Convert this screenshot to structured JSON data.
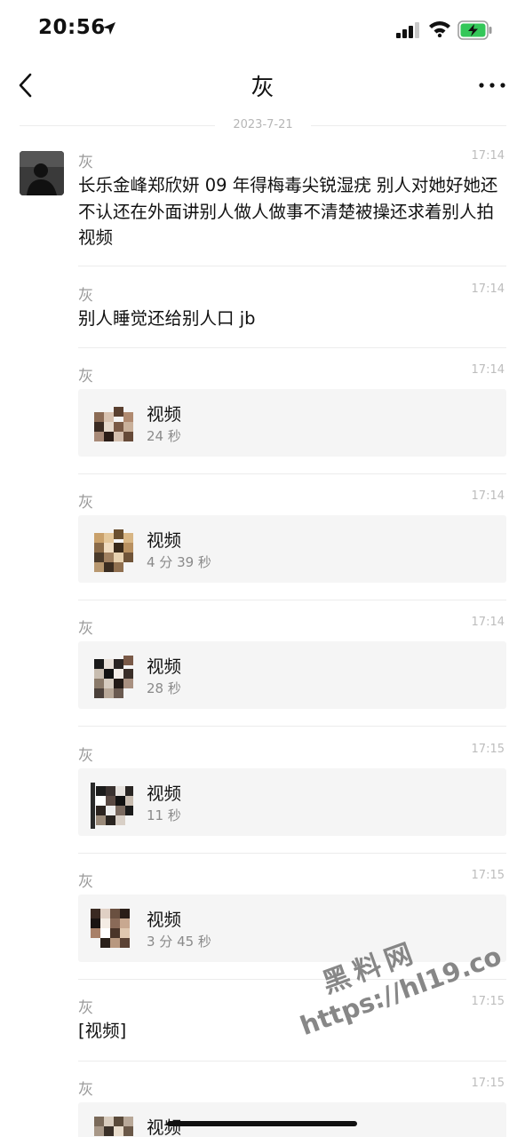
{
  "status": {
    "time": "20:56"
  },
  "nav": {
    "title": "灰"
  },
  "date_divider": "2023-7-21",
  "messages": [
    {
      "sender": "灰",
      "time": "17:14",
      "type": "text",
      "text": "长乐金峰郑欣妍 09 年得梅毒尖锐湿疣 别人对她好她还不认还在外面讲别人做人做事不清楚被操还求着别人拍视频"
    },
    {
      "sender": "灰",
      "time": "17:14",
      "type": "text",
      "text": "别人睡觉还给别人口 jb"
    },
    {
      "sender": "灰",
      "time": "17:14",
      "type": "video",
      "title": "视频",
      "duration": "24 秒"
    },
    {
      "sender": "灰",
      "time": "17:14",
      "type": "video",
      "title": "视频",
      "duration": "4 分 39 秒"
    },
    {
      "sender": "灰",
      "time": "17:14",
      "type": "video",
      "title": "视频",
      "duration": "28 秒"
    },
    {
      "sender": "灰",
      "time": "17:15",
      "type": "video",
      "title": "视频",
      "duration": "11 秒"
    },
    {
      "sender": "灰",
      "time": "17:15",
      "type": "video",
      "title": "视频",
      "duration": "3 分 45 秒"
    },
    {
      "sender": "灰",
      "time": "17:15",
      "type": "text",
      "text": "[视频]"
    },
    {
      "sender": "灰",
      "time": "17:15",
      "type": "video",
      "title": "视频",
      "duration": ""
    }
  ],
  "watermark": {
    "cn": "黑料网",
    "url": "https://hl19.co"
  }
}
